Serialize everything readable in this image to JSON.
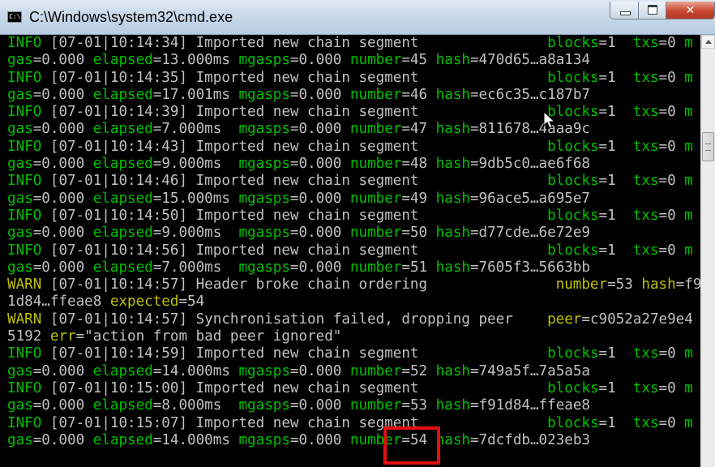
{
  "window": {
    "title": "C:\\Windows\\system32\\cmd.exe",
    "icon": "cmd-icon",
    "controls": {
      "minimize": "minimize-icon",
      "maximize": "maximize-icon",
      "close_label": "✕"
    }
  },
  "colors": {
    "background": "#000000",
    "text": "#c0c0c0",
    "info_green": "#00c000",
    "warn_yellow": "#c0c000",
    "highlight": "#e01010"
  },
  "console": {
    "lines": [
      [
        [
          "g",
          "INFO"
        ],
        [
          "t",
          " [07-01|10:14:34] Imported new chain segment               "
        ],
        [
          "g",
          "blocks"
        ],
        [
          "t",
          "=1  "
        ],
        [
          "g",
          "txs"
        ],
        [
          "t",
          "=0 "
        ],
        [
          "g",
          "m"
        ]
      ],
      [
        [
          "g",
          "gas"
        ],
        [
          "t",
          "=0.000 "
        ],
        [
          "g",
          "elapsed"
        ],
        [
          "t",
          "=13.000ms "
        ],
        [
          "g",
          "mgasps"
        ],
        [
          "t",
          "=0.000 "
        ],
        [
          "g",
          "number"
        ],
        [
          "t",
          "=45 "
        ],
        [
          "g",
          "hash"
        ],
        [
          "t",
          "=470d65…a8a134"
        ]
      ],
      [
        [
          "g",
          "INFO"
        ],
        [
          "t",
          " [07-01|10:14:35] Imported new chain segment               "
        ],
        [
          "g",
          "blocks"
        ],
        [
          "t",
          "=1  "
        ],
        [
          "g",
          "txs"
        ],
        [
          "t",
          "=0 "
        ],
        [
          "g",
          "m"
        ]
      ],
      [
        [
          "g",
          "gas"
        ],
        [
          "t",
          "=0.000 "
        ],
        [
          "g",
          "elapsed"
        ],
        [
          "t",
          "=17.001ms "
        ],
        [
          "g",
          "mgasps"
        ],
        [
          "t",
          "=0.000 "
        ],
        [
          "g",
          "number"
        ],
        [
          "t",
          "=46 "
        ],
        [
          "g",
          "hash"
        ],
        [
          "t",
          "=ec6c35…c187b7"
        ]
      ],
      [
        [
          "g",
          "INFO"
        ],
        [
          "t",
          " [07-01|10:14:39] Imported new chain segment               "
        ],
        [
          "g",
          "blocks"
        ],
        [
          "t",
          "=1  "
        ],
        [
          "g",
          "txs"
        ],
        [
          "t",
          "=0 "
        ],
        [
          "g",
          "m"
        ]
      ],
      [
        [
          "g",
          "gas"
        ],
        [
          "t",
          "=0.000 "
        ],
        [
          "g",
          "elapsed"
        ],
        [
          "t",
          "=7.000ms  "
        ],
        [
          "g",
          "mgasps"
        ],
        [
          "t",
          "=0.000 "
        ],
        [
          "g",
          "number"
        ],
        [
          "t",
          "=47 "
        ],
        [
          "g",
          "hash"
        ],
        [
          "t",
          "=811678…4aaa9c"
        ]
      ],
      [
        [
          "g",
          "INFO"
        ],
        [
          "t",
          " [07-01|10:14:43] Imported new chain segment               "
        ],
        [
          "g",
          "blocks"
        ],
        [
          "t",
          "=1  "
        ],
        [
          "g",
          "txs"
        ],
        [
          "t",
          "=0 "
        ],
        [
          "g",
          "m"
        ]
      ],
      [
        [
          "g",
          "gas"
        ],
        [
          "t",
          "=0.000 "
        ],
        [
          "g",
          "elapsed"
        ],
        [
          "t",
          "=9.000ms  "
        ],
        [
          "g",
          "mgasps"
        ],
        [
          "t",
          "=0.000 "
        ],
        [
          "g",
          "number"
        ],
        [
          "t",
          "=48 "
        ],
        [
          "g",
          "hash"
        ],
        [
          "t",
          "=9db5c0…ae6f68"
        ]
      ],
      [
        [
          "g",
          "INFO"
        ],
        [
          "t",
          " [07-01|10:14:46] Imported new chain segment               "
        ],
        [
          "g",
          "blocks"
        ],
        [
          "t",
          "=1  "
        ],
        [
          "g",
          "txs"
        ],
        [
          "t",
          "=0 "
        ],
        [
          "g",
          "m"
        ]
      ],
      [
        [
          "g",
          "gas"
        ],
        [
          "t",
          "=0.000 "
        ],
        [
          "g",
          "elapsed"
        ],
        [
          "t",
          "=15.000ms "
        ],
        [
          "g",
          "mgasps"
        ],
        [
          "t",
          "=0.000 "
        ],
        [
          "g",
          "number"
        ],
        [
          "t",
          "=49 "
        ],
        [
          "g",
          "hash"
        ],
        [
          "t",
          "=96ace5…a695e7"
        ]
      ],
      [
        [
          "g",
          "INFO"
        ],
        [
          "t",
          " [07-01|10:14:50] Imported new chain segment               "
        ],
        [
          "g",
          "blocks"
        ],
        [
          "t",
          "=1  "
        ],
        [
          "g",
          "txs"
        ],
        [
          "t",
          "=0 "
        ],
        [
          "g",
          "m"
        ]
      ],
      [
        [
          "g",
          "gas"
        ],
        [
          "t",
          "=0.000 "
        ],
        [
          "g",
          "elapsed"
        ],
        [
          "t",
          "=9.000ms  "
        ],
        [
          "g",
          "mgasps"
        ],
        [
          "t",
          "=0.000 "
        ],
        [
          "g",
          "number"
        ],
        [
          "t",
          "=50 "
        ],
        [
          "g",
          "hash"
        ],
        [
          "t",
          "=d77cde…6e72e9"
        ]
      ],
      [
        [
          "g",
          "INFO"
        ],
        [
          "t",
          " [07-01|10:14:56] Imported new chain segment               "
        ],
        [
          "g",
          "blocks"
        ],
        [
          "t",
          "=1  "
        ],
        [
          "g",
          "txs"
        ],
        [
          "t",
          "=0 "
        ],
        [
          "g",
          "m"
        ]
      ],
      [
        [
          "g",
          "gas"
        ],
        [
          "t",
          "=0.000 "
        ],
        [
          "g",
          "elapsed"
        ],
        [
          "t",
          "=7.000ms  "
        ],
        [
          "g",
          "mgasps"
        ],
        [
          "t",
          "=0.000 "
        ],
        [
          "g",
          "number"
        ],
        [
          "t",
          "=51 "
        ],
        [
          "g",
          "hash"
        ],
        [
          "t",
          "=7605f3…5663bb"
        ]
      ],
      [
        [
          "y",
          "WARN"
        ],
        [
          "t",
          " [07-01|10:14:57] Header broke chain ordering               "
        ],
        [
          "y",
          "number"
        ],
        [
          "t",
          "=53 "
        ],
        [
          "y",
          "hash"
        ],
        [
          "t",
          "=f9"
        ]
      ],
      [
        [
          "t",
          "1d84…ffeae8 "
        ],
        [
          "y",
          "expected"
        ],
        [
          "t",
          "=54"
        ]
      ],
      [
        [
          "y",
          "WARN"
        ],
        [
          "t",
          " [07-01|10:14:57] Synchronisation failed, dropping peer    "
        ],
        [
          "y",
          "peer"
        ],
        [
          "t",
          "=c9052a27e9e4"
        ]
      ],
      [
        [
          "t",
          "5192 "
        ],
        [
          "y",
          "err"
        ],
        [
          "t",
          "=\"action from bad peer ignored\""
        ]
      ],
      [
        [
          "g",
          "INFO"
        ],
        [
          "t",
          " [07-01|10:14:59] Imported new chain segment               "
        ],
        [
          "g",
          "blocks"
        ],
        [
          "t",
          "=1  "
        ],
        [
          "g",
          "txs"
        ],
        [
          "t",
          "=0 "
        ],
        [
          "g",
          "m"
        ]
      ],
      [
        [
          "g",
          "gas"
        ],
        [
          "t",
          "=0.000 "
        ],
        [
          "g",
          "elapsed"
        ],
        [
          "t",
          "=14.000ms "
        ],
        [
          "g",
          "mgasps"
        ],
        [
          "t",
          "=0.000 "
        ],
        [
          "g",
          "number"
        ],
        [
          "t",
          "=52 "
        ],
        [
          "g",
          "hash"
        ],
        [
          "t",
          "=749a5f…7a5a5a"
        ]
      ],
      [
        [
          "g",
          "INFO"
        ],
        [
          "t",
          " [07-01|10:15:00] Imported new chain segment               "
        ],
        [
          "g",
          "blocks"
        ],
        [
          "t",
          "=1  "
        ],
        [
          "g",
          "txs"
        ],
        [
          "t",
          "=0 "
        ],
        [
          "g",
          "m"
        ]
      ],
      [
        [
          "g",
          "gas"
        ],
        [
          "t",
          "=0.000 "
        ],
        [
          "g",
          "elapsed"
        ],
        [
          "t",
          "=8.000ms  "
        ],
        [
          "g",
          "mgasps"
        ],
        [
          "t",
          "=0.000 "
        ],
        [
          "g",
          "number"
        ],
        [
          "t",
          "=53 "
        ],
        [
          "g",
          "hash"
        ],
        [
          "t",
          "=f91d84…ffeae8"
        ]
      ],
      [
        [
          "g",
          "INFO"
        ],
        [
          "t",
          " [07-01|10:15:07] Imported new chain segment               "
        ],
        [
          "g",
          "blocks"
        ],
        [
          "t",
          "=1  "
        ],
        [
          "g",
          "txs"
        ],
        [
          "t",
          "=0 "
        ],
        [
          "g",
          "m"
        ]
      ],
      [
        [
          "g",
          "gas"
        ],
        [
          "t",
          "=0.000 "
        ],
        [
          "g",
          "elapsed"
        ],
        [
          "t",
          "=14.000ms "
        ],
        [
          "g",
          "mgasps"
        ],
        [
          "t",
          "=0.000 "
        ],
        [
          "g",
          "number"
        ],
        [
          "t",
          "=54 "
        ],
        [
          "g",
          "hash"
        ],
        [
          "t",
          "=7dcfdb…023eb3"
        ]
      ]
    ]
  },
  "annotation": {
    "highlight": "red-highlight-box"
  }
}
